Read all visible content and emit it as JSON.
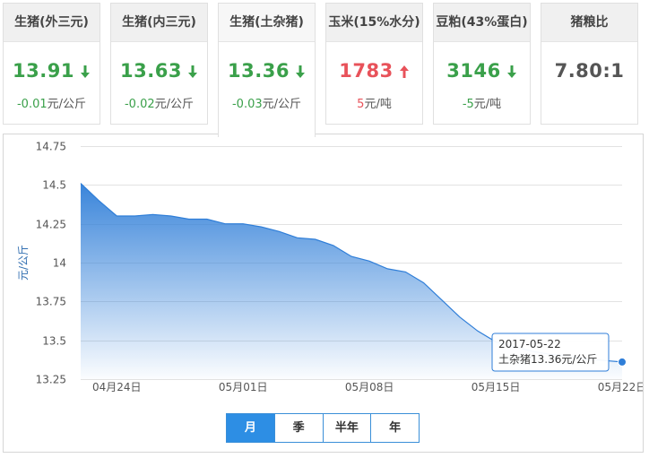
{
  "cards": [
    {
      "title": "生猪(外三元)",
      "price": "13.91",
      "dir": "down",
      "change": "-0.01",
      "unit": "元/公斤"
    },
    {
      "title": "生猪(内三元)",
      "price": "13.63",
      "dir": "down",
      "change": "-0.02",
      "unit": "元/公斤"
    },
    {
      "title": "生猪(土杂猪)",
      "price": "13.36",
      "dir": "down",
      "change": "-0.03",
      "unit": "元/公斤",
      "active": true
    },
    {
      "title": "玉米(15%水分)",
      "price": "1783",
      "dir": "up",
      "change": "5",
      "unit": "元/吨"
    },
    {
      "title": "豆粕(43%蛋白)",
      "price": "3146",
      "dir": "down",
      "change": "-5",
      "unit": "元/吨"
    },
    {
      "title": "猪粮比",
      "price": "7.80:1",
      "dir": "flat",
      "change": "",
      "unit": ""
    }
  ],
  "colors": {
    "down": "#3aa04a",
    "up": "#e8525a",
    "series_line": "#2f7ed8",
    "area_top": "#2f7ed8",
    "tab_active": "#2d8ee4"
  },
  "chart_data": {
    "type": "area",
    "title": "",
    "ylabel": "元/公斤",
    "xlabel": "",
    "ylim": [
      13.25,
      14.75
    ],
    "yticks": [
      "14.75",
      "14.5",
      "14.25",
      "14",
      "13.75",
      "13.5",
      "13.25"
    ],
    "xticks": [
      "04月24日",
      "05月01日",
      "05月08日",
      "05月15日",
      "05月22日"
    ],
    "xrange": [
      "2017-04-22",
      "2017-05-22"
    ],
    "grid": true,
    "x": [
      "2017-04-22",
      "2017-04-23",
      "2017-04-24",
      "2017-04-25",
      "2017-04-26",
      "2017-04-27",
      "2017-04-28",
      "2017-04-29",
      "2017-04-30",
      "2017-05-01",
      "2017-05-02",
      "2017-05-03",
      "2017-05-04",
      "2017-05-05",
      "2017-05-06",
      "2017-05-07",
      "2017-05-08",
      "2017-05-09",
      "2017-05-10",
      "2017-05-11",
      "2017-05-12",
      "2017-05-13",
      "2017-05-14",
      "2017-05-15",
      "2017-05-16",
      "2017-05-17",
      "2017-05-18",
      "2017-05-19",
      "2017-05-20",
      "2017-05-21",
      "2017-05-22"
    ],
    "values": [
      14.51,
      14.4,
      14.3,
      14.3,
      14.31,
      14.3,
      14.28,
      14.28,
      14.25,
      14.25,
      14.23,
      14.2,
      14.16,
      14.15,
      14.11,
      14.04,
      14.01,
      13.96,
      13.94,
      13.87,
      13.76,
      13.65,
      13.56,
      13.49,
      13.46,
      13.43,
      13.41,
      13.4,
      13.38,
      13.37,
      13.36
    ],
    "tooltip": {
      "date": "2017-05-22",
      "text": "土杂猪13.36元/公斤"
    }
  },
  "range_tabs": {
    "items": [
      "月",
      "季",
      "半年",
      "年"
    ],
    "active": "月"
  }
}
